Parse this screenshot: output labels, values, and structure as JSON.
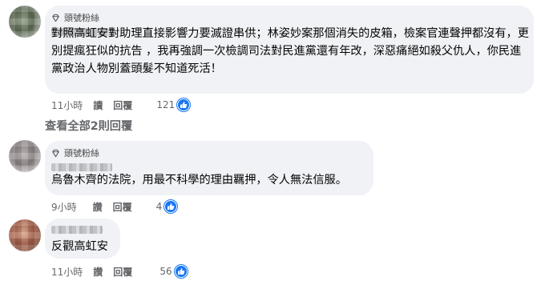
{
  "comments": [
    {
      "badge": "頭號粉絲",
      "text": "對照高虹安對助理直接影響力要滅證串供；林姿妙案那個消失的皮箱，檢案官連聲押都沒有，更別提瘋狂似的抗告 ，我再強調一次檢調司法對民進黨還有年改，深惡痛絕如殺父仇人，你民進黨政治人物別蓋頭髮不知道死活！",
      "time": "11小時",
      "reply_label": "讀",
      "reply2_label": "回覆",
      "reactions": "121",
      "reaction_icon": "like-icon"
    },
    {
      "badge": "頭號粉絲",
      "text": "烏魯木齊的法院，用最不科學的理由羈押，令人無法信服。",
      "time": "9小時",
      "reply_label": "讚",
      "reply2_label": "回覆",
      "reactions": "4",
      "reaction_icon": "like-icon"
    },
    {
      "text": "反觀高虹安",
      "time": "11小時",
      "reply_label": "讚",
      "reply2_label": "回覆",
      "reactions": "56",
      "reaction_icon": "like-icon"
    }
  ],
  "view_replies": "查看全部2則回覆",
  "colors": {
    "bubble": "#f0f2f5",
    "like_blue": "#1877f2",
    "meta_gray": "#65676b"
  }
}
